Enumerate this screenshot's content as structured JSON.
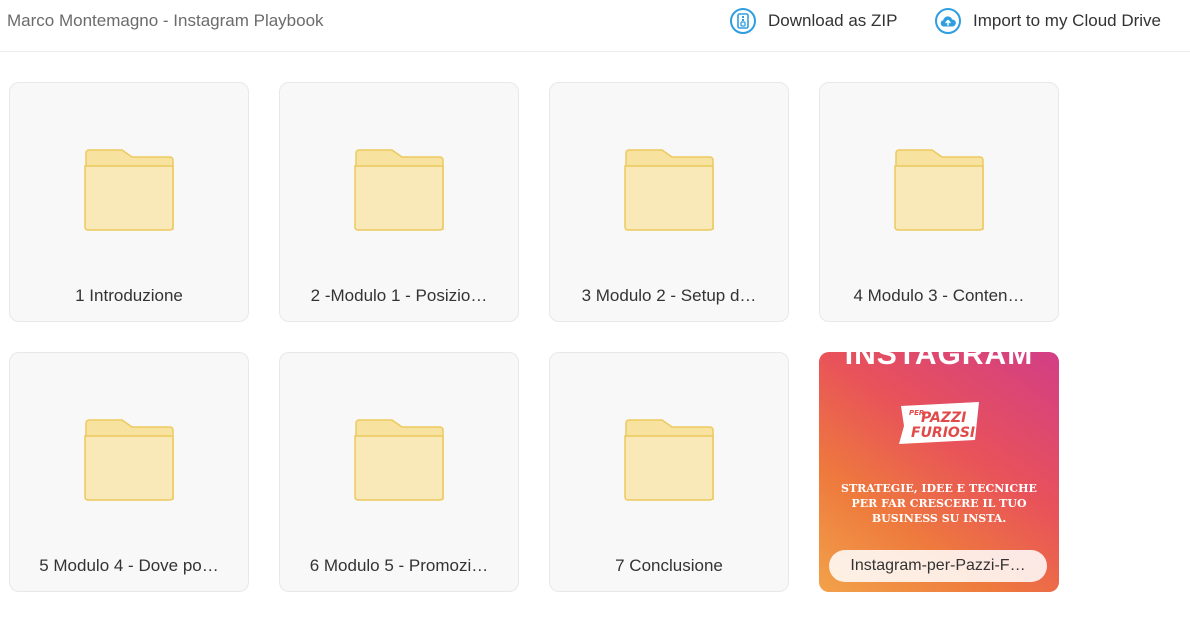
{
  "header": {
    "title": "Marco Montemagno - Instagram Playbook",
    "download_label": "Download as ZIP",
    "import_label": "Import to my Cloud Drive",
    "accent_color": "#2f9ee0"
  },
  "folders": [
    {
      "label": "1 Introduzione"
    },
    {
      "label": "2 -Modulo 1 - Posizio…"
    },
    {
      "label": "3 Modulo 2 - Setup d…"
    },
    {
      "label": "4 Modulo 3 - Conten…"
    },
    {
      "label": "5 Modulo 4 - Dove po…"
    },
    {
      "label": "6 Modulo 5 - Promozi…"
    },
    {
      "label": "7 Conclusione"
    }
  ],
  "file": {
    "label": "Instagram-per-Pazzi-F…",
    "thumbnail": {
      "heading": "INSTAGRAM",
      "logo_line1": "PER",
      "logo_line2": "PAZZI",
      "logo_line3": "FURIOSI",
      "tagline_1": "STRATEGIE, IDEE E TECNICHE",
      "tagline_2": "PER FAR CRESCERE IL TUO",
      "tagline_3": "BUSINESS SU INSTA."
    }
  },
  "icons": {
    "folder": "folder-icon",
    "zip": "zip-icon",
    "cloud_upload": "cloud-upload-icon"
  },
  "colors": {
    "folder_fill": "#f9e9b8",
    "folder_tab": "#f7e2a0",
    "folder_stroke": "#ecc95e"
  }
}
